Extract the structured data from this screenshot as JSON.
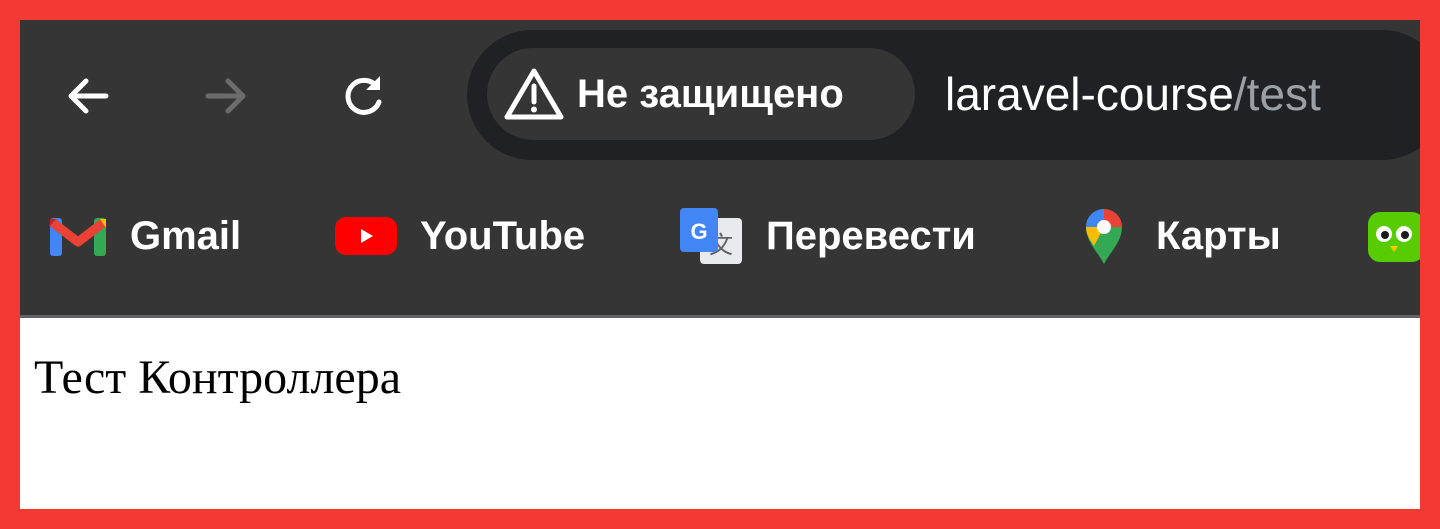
{
  "browser": {
    "security_label": "Не защищено",
    "url_host": "laravel-course",
    "url_path": "/test",
    "icons": {
      "back": "arrow-left-icon",
      "forward": "arrow-right-icon",
      "reload": "reload-icon",
      "warning": "warning-triangle-icon"
    }
  },
  "bookmarks": [
    {
      "label": "Gmail",
      "icon": "gmail-icon"
    },
    {
      "label": "YouTube",
      "icon": "youtube-icon"
    },
    {
      "label": "Перевести",
      "icon": "google-translate-icon"
    },
    {
      "label": "Карты",
      "icon": "google-maps-icon"
    },
    {
      "label": "",
      "icon": "duolingo-icon"
    }
  ],
  "page": {
    "text": "Тест Контроллера"
  },
  "colors": {
    "frame": "#f23a33",
    "toolbar": "#353535",
    "omnibox": "#202124"
  }
}
